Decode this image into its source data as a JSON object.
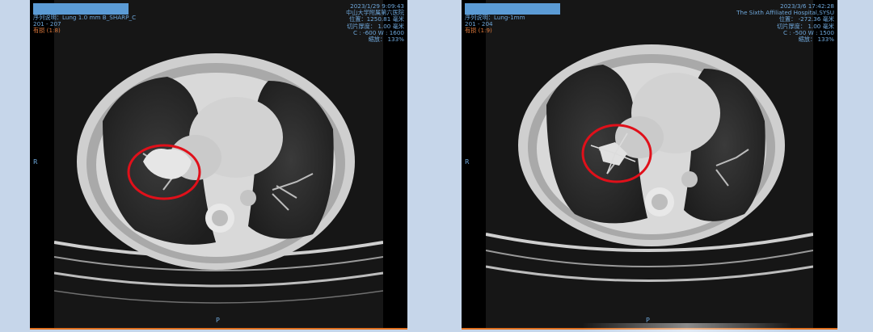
{
  "left_viewer": {
    "series_line": "序列说明：Lung 1.0 mm B_SHARP_C",
    "range": "201 - 207",
    "marked": "有损 (1:8)",
    "datetime": "2023/1/29 9:09:43",
    "hospital": "中山大学附属第六医院",
    "position": "位置：1250.81 毫米",
    "thickness": "切片厚度： 1.00 毫米",
    "window": "C : -600 W : 1600",
    "zoom": "缩放： 133%",
    "orient_side": "R",
    "orient_bottom": "P"
  },
  "right_viewer": {
    "series_line": "序列说明：Lung-1mm",
    "range": "201 - 204",
    "marked": "有损 (1:9)",
    "datetime": "2023/3/6 17:42:28",
    "hospital": "The Sixth Affiliated Hospital,SYSU",
    "position": "位置： -272.36 毫米",
    "thickness": "切片厚度： 1.00 毫米",
    "window": "C : -500 W : 1500",
    "zoom": "缩放： 133%",
    "orient_side": "R",
    "orient_bottom": "P"
  },
  "colors": {
    "background": "#c6d6ea",
    "overlay_text": "#6fa8dc",
    "lossy_text": "#e07a3c",
    "annotation_circle": "#e0101a",
    "redaction": "#5b9bd5"
  }
}
